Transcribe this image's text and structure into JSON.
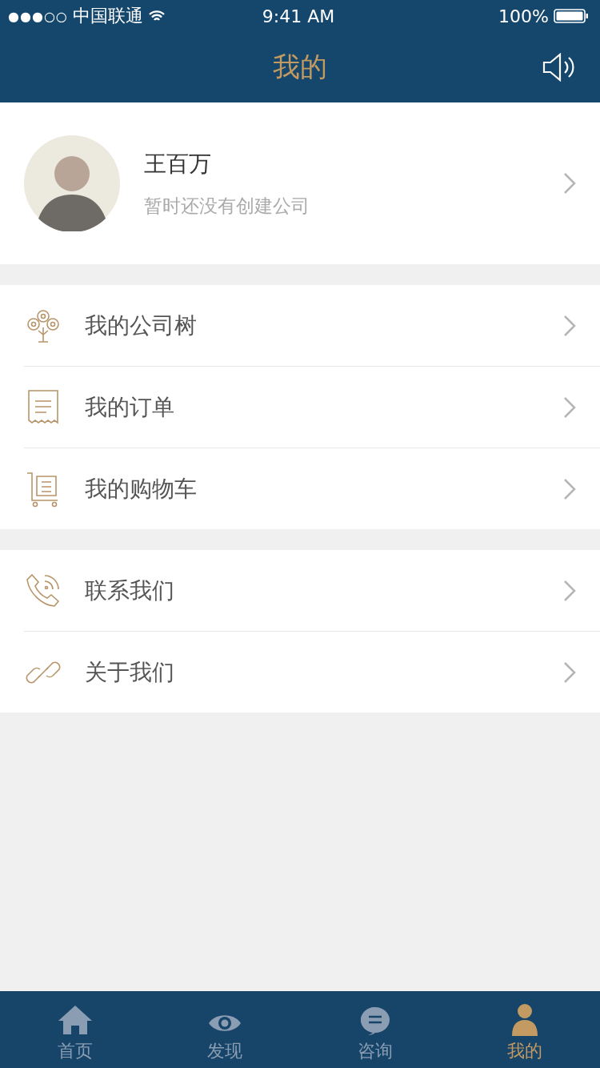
{
  "status_bar": {
    "signal": "●●●○○",
    "carrier": "中国联通",
    "time": "9:41 AM",
    "battery": "100%"
  },
  "nav": {
    "title": "我的"
  },
  "profile": {
    "name": "王百万",
    "subtitle": "暂时还没有创建公司"
  },
  "menu_groups": [
    [
      {
        "label": "我的公司树"
      },
      {
        "label": "我的订单"
      },
      {
        "label": "我的购物车"
      }
    ],
    [
      {
        "label": "联系我们"
      },
      {
        "label": "关于我们"
      }
    ]
  ],
  "tabs": [
    {
      "label": "首页",
      "selected": false
    },
    {
      "label": "发现",
      "selected": false
    },
    {
      "label": "咨询",
      "selected": false
    },
    {
      "label": "我的",
      "selected": true
    }
  ]
}
